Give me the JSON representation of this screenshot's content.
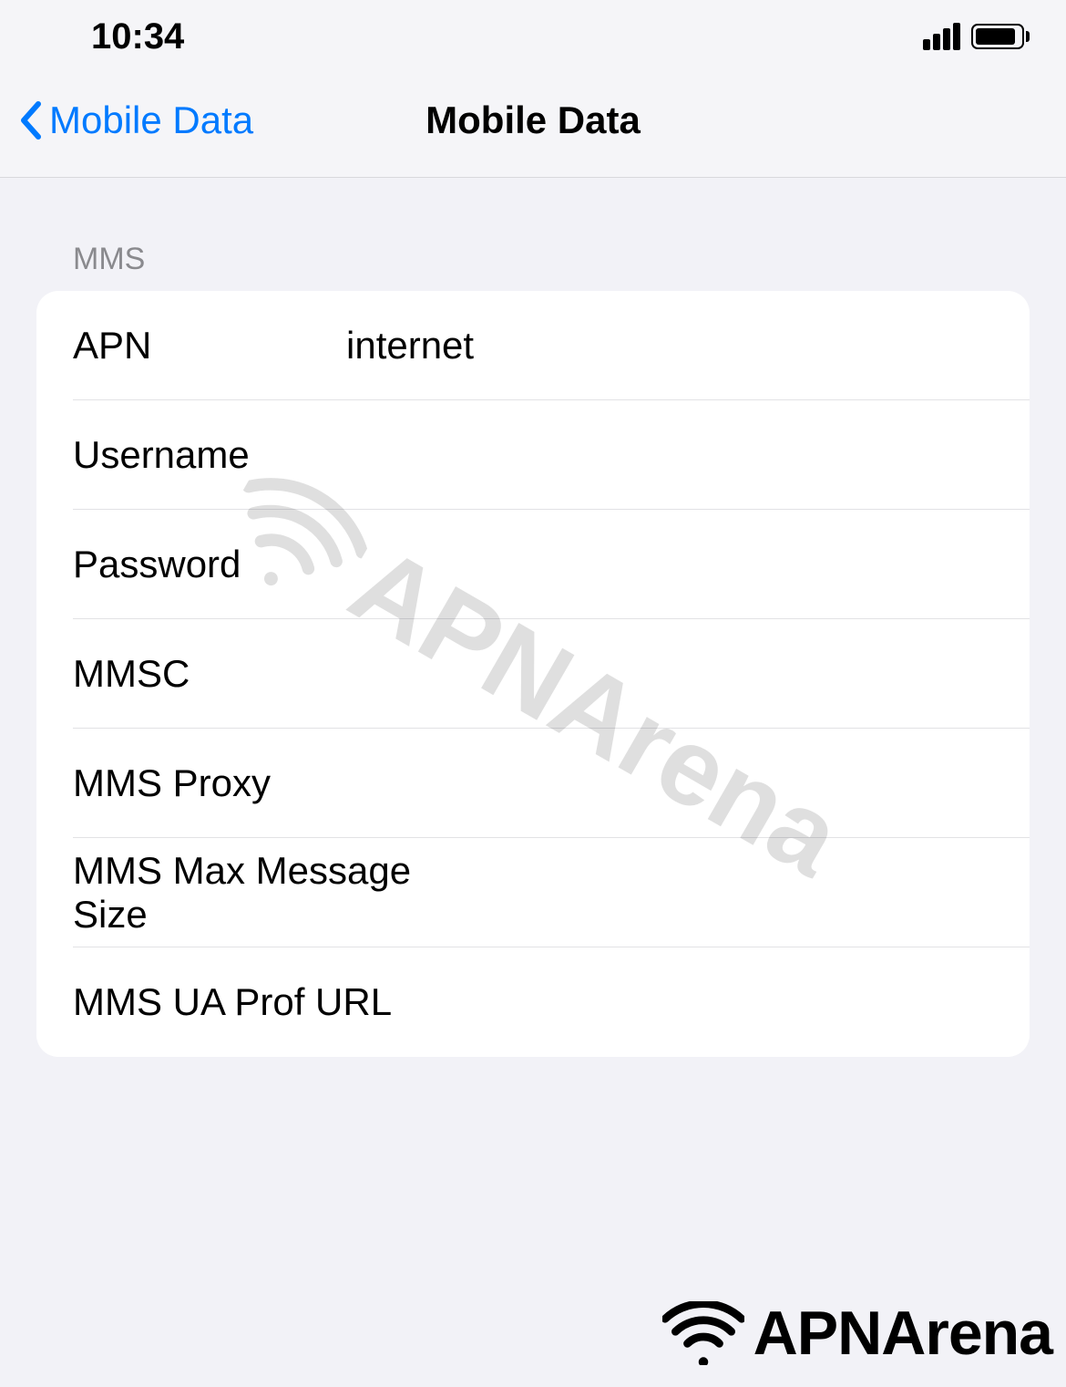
{
  "statusBar": {
    "time": "10:34"
  },
  "navBar": {
    "backLabel": "Mobile Data",
    "title": "Mobile Data"
  },
  "section": {
    "header": "MMS",
    "rows": [
      {
        "label": "APN",
        "value": "internet"
      },
      {
        "label": "Username",
        "value": ""
      },
      {
        "label": "Password",
        "value": ""
      },
      {
        "label": "MMSC",
        "value": ""
      },
      {
        "label": "MMS Proxy",
        "value": ""
      },
      {
        "label": "MMS Max Message Size",
        "value": ""
      },
      {
        "label": "MMS UA Prof URL",
        "value": ""
      }
    ]
  },
  "watermark": {
    "brand": "APNArena"
  }
}
